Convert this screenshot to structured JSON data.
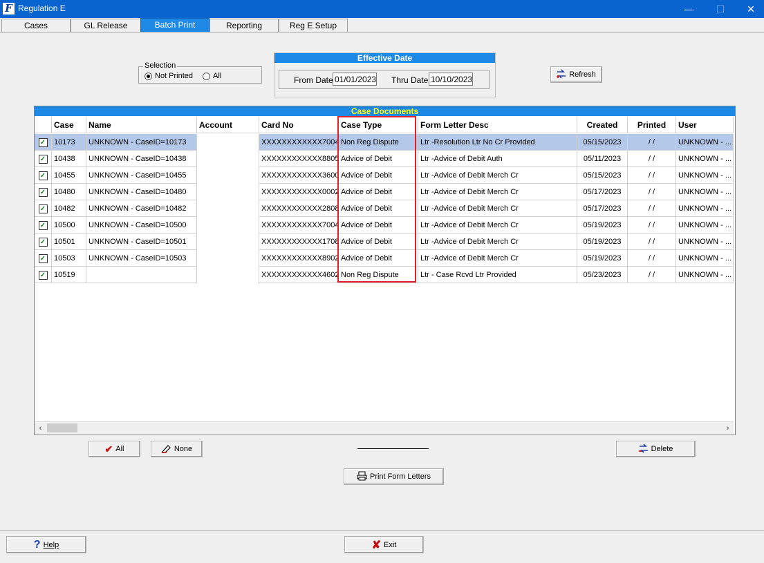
{
  "window": {
    "title": "Regulation E",
    "minimize": "—",
    "maximize": "☐",
    "close": "✕"
  },
  "tabs": [
    "Cases",
    "GL Release",
    "Batch Print",
    "Reporting",
    "Reg E Setup"
  ],
  "selection": {
    "label": "Selection",
    "not_printed": "Not Printed",
    "all": "All",
    "selected": "not_printed"
  },
  "effective_date": {
    "title": "Effective Date",
    "from_label": "From Date",
    "from_value": "01/01/2023",
    "thru_label": "Thru Date",
    "thru_value": "10/10/2023"
  },
  "refresh_label": "Refresh",
  "grid": {
    "title": "Case Documents",
    "columns": [
      "Case",
      "Name",
      "Account",
      "Card No",
      "Case Type",
      "Form Letter Desc",
      "Created",
      "Printed",
      "User"
    ],
    "rows": [
      {
        "case": "10173",
        "name": "UNKNOWN - CaseID=10173",
        "account": "",
        "card": "XXXXXXXXXXXX7004",
        "type": "Non Reg Dispute",
        "letter": "Ltr -Resolution Ltr No Cr Provided",
        "created": "05/15/2023",
        "printed": "/ /",
        "user": "UNKNOWN - ..."
      },
      {
        "case": "10438",
        "name": "UNKNOWN - CaseID=10438",
        "account": "",
        "card": "XXXXXXXXXXXX8805",
        "type": "Advice of Debit",
        "letter": "Ltr -Advice of Debit Auth",
        "created": "05/11/2023",
        "printed": "/ /",
        "user": "UNKNOWN - ..."
      },
      {
        "case": "10455",
        "name": "UNKNOWN - CaseID=10455",
        "account": "",
        "card": "XXXXXXXXXXXX3600",
        "type": "Advice of Debit",
        "letter": "Ltr -Advice of Debit Merch Cr",
        "created": "05/15/2023",
        "printed": "/ /",
        "user": "UNKNOWN - ..."
      },
      {
        "case": "10480",
        "name": "UNKNOWN - CaseID=10480",
        "account": "",
        "card": "XXXXXXXXXXXX0002",
        "type": "Advice of Debit",
        "letter": "Ltr -Advice of Debit Merch Cr",
        "created": "05/17/2023",
        "printed": "/ /",
        "user": "UNKNOWN - ..."
      },
      {
        "case": "10482",
        "name": "UNKNOWN - CaseID=10482",
        "account": "",
        "card": "XXXXXXXXXXXX2808",
        "type": "Advice of Debit",
        "letter": "Ltr -Advice of Debit Merch Cr",
        "created": "05/17/2023",
        "printed": "/ /",
        "user": "UNKNOWN - ..."
      },
      {
        "case": "10500",
        "name": "UNKNOWN - CaseID=10500",
        "account": "",
        "card": "XXXXXXXXXXXX7004",
        "type": "Advice of Debit",
        "letter": "Ltr -Advice of Debit Merch Cr",
        "created": "05/19/2023",
        "printed": "/ /",
        "user": "UNKNOWN - ..."
      },
      {
        "case": "10501",
        "name": "UNKNOWN - CaseID=10501",
        "account": "",
        "card": "XXXXXXXXXXXX1708",
        "type": "Advice of Debit",
        "letter": "Ltr -Advice of Debit Merch Cr",
        "created": "05/19/2023",
        "printed": "/ /",
        "user": "UNKNOWN - ..."
      },
      {
        "case": "10503",
        "name": "UNKNOWN - CaseID=10503",
        "account": "",
        "card": "XXXXXXXXXXXX8902",
        "type": "Advice of Debit",
        "letter": "Ltr -Advice of Debit Merch Cr",
        "created": "05/19/2023",
        "printed": "/ /",
        "user": "UNKNOWN - ..."
      },
      {
        "case": "10519",
        "name": "",
        "account": "",
        "card": "XXXXXXXXXXXX4602",
        "type": "Non Reg Dispute",
        "letter": "Ltr - Case Rcvd Ltr Provided",
        "created": "05/23/2023",
        "printed": "/ /",
        "user": "UNKNOWN - ..."
      }
    ]
  },
  "buttons": {
    "all": "All",
    "none": "None",
    "delete": "Delete",
    "print": "Print Form Letters",
    "help": "Help",
    "exit": "Exit"
  },
  "colors": {
    "title_bar": "#0a64cf",
    "accent": "#1e88e5",
    "highlight": "#e0202a",
    "grid_title_text": "#ffff00",
    "selected_row": "#b4c8ea"
  }
}
